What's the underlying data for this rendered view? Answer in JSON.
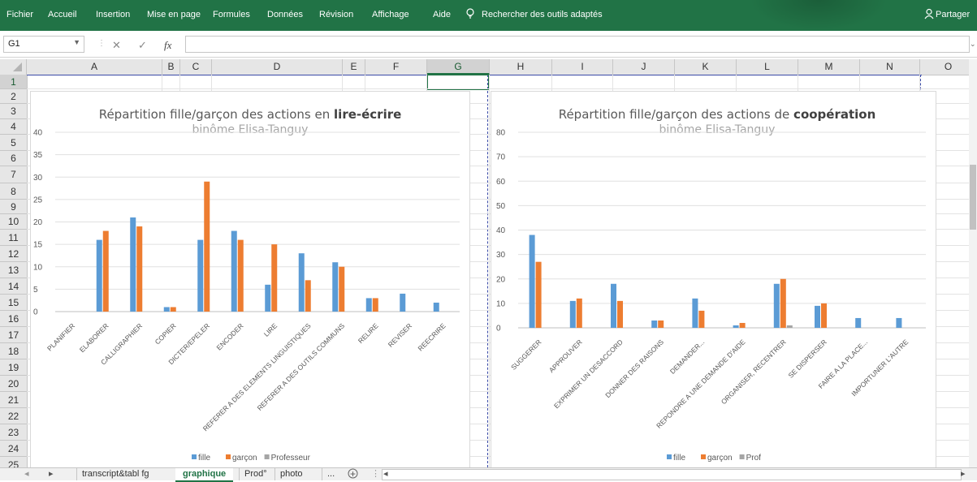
{
  "ribbon": {
    "tabs": [
      "Fichier",
      "Accueil",
      "Insertion",
      "Mise en page",
      "Formules",
      "Données",
      "Révision",
      "Affichage",
      "Aide"
    ],
    "search_text": "Rechercher des outils adaptés",
    "share_label": "Partager",
    "color": "#217346"
  },
  "formula_bar": {
    "name_box": "G1",
    "cancel_symbol": "✕",
    "enter_symbol": "✓",
    "fx_symbol": "fx",
    "content": ""
  },
  "grid": {
    "columns": [
      "A",
      "B",
      "C",
      "D",
      "E",
      "F",
      "G",
      "H",
      "I",
      "J",
      "K",
      "L",
      "M",
      "N",
      "O"
    ],
    "selected_column": "G",
    "rows": [
      "1",
      "2",
      "3",
      "4",
      "5",
      "6",
      "7",
      "8",
      "9",
      "10",
      "11",
      "12",
      "13",
      "14",
      "15",
      "16",
      "17",
      "18",
      "19",
      "20",
      "21",
      "22",
      "23",
      "24",
      "25"
    ],
    "selected_row": "1"
  },
  "sheet_tabs": {
    "tabs": [
      "transcript&tabl fg",
      "graphique",
      "Prod°",
      "photo",
      "..."
    ],
    "active": "graphique",
    "add_symbol": "+"
  },
  "chart_data": [
    {
      "type": "bar",
      "title_regular": "Répartition fille/garçon des actions en ",
      "title_bold": "lire-écrire",
      "subtitle": "binôme Elisa-Tanguy",
      "ylim": [
        0,
        40
      ],
      "yticks": [
        0,
        5,
        10,
        15,
        20,
        25,
        30,
        35,
        40
      ],
      "grid": true,
      "legend_position": "bottom",
      "categories": [
        "PLANIFIER",
        "ELABORER",
        "CALLIGRAPHIER",
        "COPIER",
        "DICTER/EPELER",
        "ENCODER",
        "LIRE",
        "REFERER A DES ELEMENTS LINGUISTIQUES",
        "REFERER A DES OUTILS COMMUNS",
        "RELIRE",
        "REVISER",
        "REECRIRE"
      ],
      "series": [
        {
          "name": "fille",
          "color": "#5b9bd5",
          "values": [
            0,
            16,
            21,
            1,
            16,
            18,
            6,
            13,
            11,
            3,
            4,
            2
          ]
        },
        {
          "name": "garçon",
          "color": "#ed7d31",
          "values": [
            0,
            18,
            19,
            1,
            29,
            16,
            15,
            7,
            10,
            3,
            0,
            0
          ]
        },
        {
          "name": "Professeur",
          "color": "#a5a5a5",
          "values": [
            0,
            0,
            0,
            0,
            0,
            0,
            0,
            0,
            0,
            0,
            0,
            0
          ]
        }
      ]
    },
    {
      "type": "bar",
      "title_regular": "Répartition fille/garçon des actions de ",
      "title_bold": "coopération",
      "subtitle": "binôme Elisa-Tanguy",
      "ylim": [
        0,
        80
      ],
      "yticks": [
        0,
        10,
        20,
        30,
        40,
        50,
        60,
        70,
        80
      ],
      "grid": true,
      "legend_position": "bottom",
      "categories": [
        "SUGGERER",
        "APPROUVER",
        "EXPRIMER UN DESACCORD",
        "DONNER DES RAISONS",
        "DEMANDER...",
        "REPONDRE A UNE DEMANDE D'AIDE",
        "ORGANISER, RECENTRER",
        "SE DISPERSER",
        "FAIRE A LA PLACE...",
        "IMPORTUNER L'AUTRE"
      ],
      "series": [
        {
          "name": "fille",
          "color": "#5b9bd5",
          "values": [
            38,
            11,
            18,
            3,
            12,
            1,
            18,
            9,
            4,
            4
          ]
        },
        {
          "name": "garçon",
          "color": "#ed7d31",
          "values": [
            27,
            12,
            11,
            3,
            7,
            2,
            20,
            10,
            0,
            0
          ]
        },
        {
          "name": "Prof",
          "color": "#a5a5a5",
          "values": [
            0,
            0,
            0,
            0,
            0,
            0,
            1,
            0,
            0,
            0
          ]
        }
      ]
    }
  ]
}
